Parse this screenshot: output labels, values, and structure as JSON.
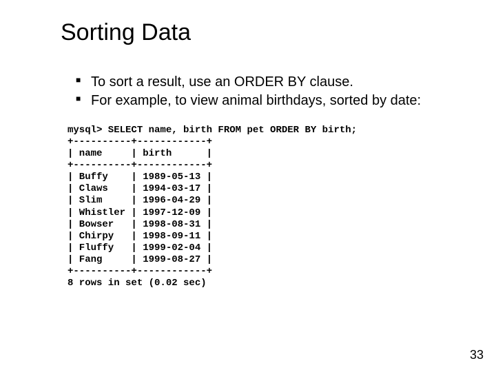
{
  "title": "Sorting Data",
  "bullets": [
    "To sort a result, use an ORDER BY clause.",
    "For example, to view animal birthdays, sorted by date:"
  ],
  "sql": {
    "prompt": "mysql> ",
    "query": "SELECT name, birth FROM pet ORDER BY birth;",
    "border": "+----------+------------+",
    "header_name": "name",
    "header_birth": "birth",
    "rows": [
      {
        "name": "Buffy",
        "birth": "1989-05-13"
      },
      {
        "name": "Claws",
        "birth": "1994-03-17"
      },
      {
        "name": "Slim",
        "birth": "1996-04-29"
      },
      {
        "name": "Whistler",
        "birth": "1997-12-09"
      },
      {
        "name": "Bowser",
        "birth": "1998-08-31"
      },
      {
        "name": "Chirpy",
        "birth": "1998-09-11"
      },
      {
        "name": "Fluffy",
        "birth": "1999-02-04"
      },
      {
        "name": "Fang",
        "birth": "1999-08-27"
      }
    ],
    "footer": "8 rows in set (0.02 sec)"
  },
  "page_number": "33"
}
